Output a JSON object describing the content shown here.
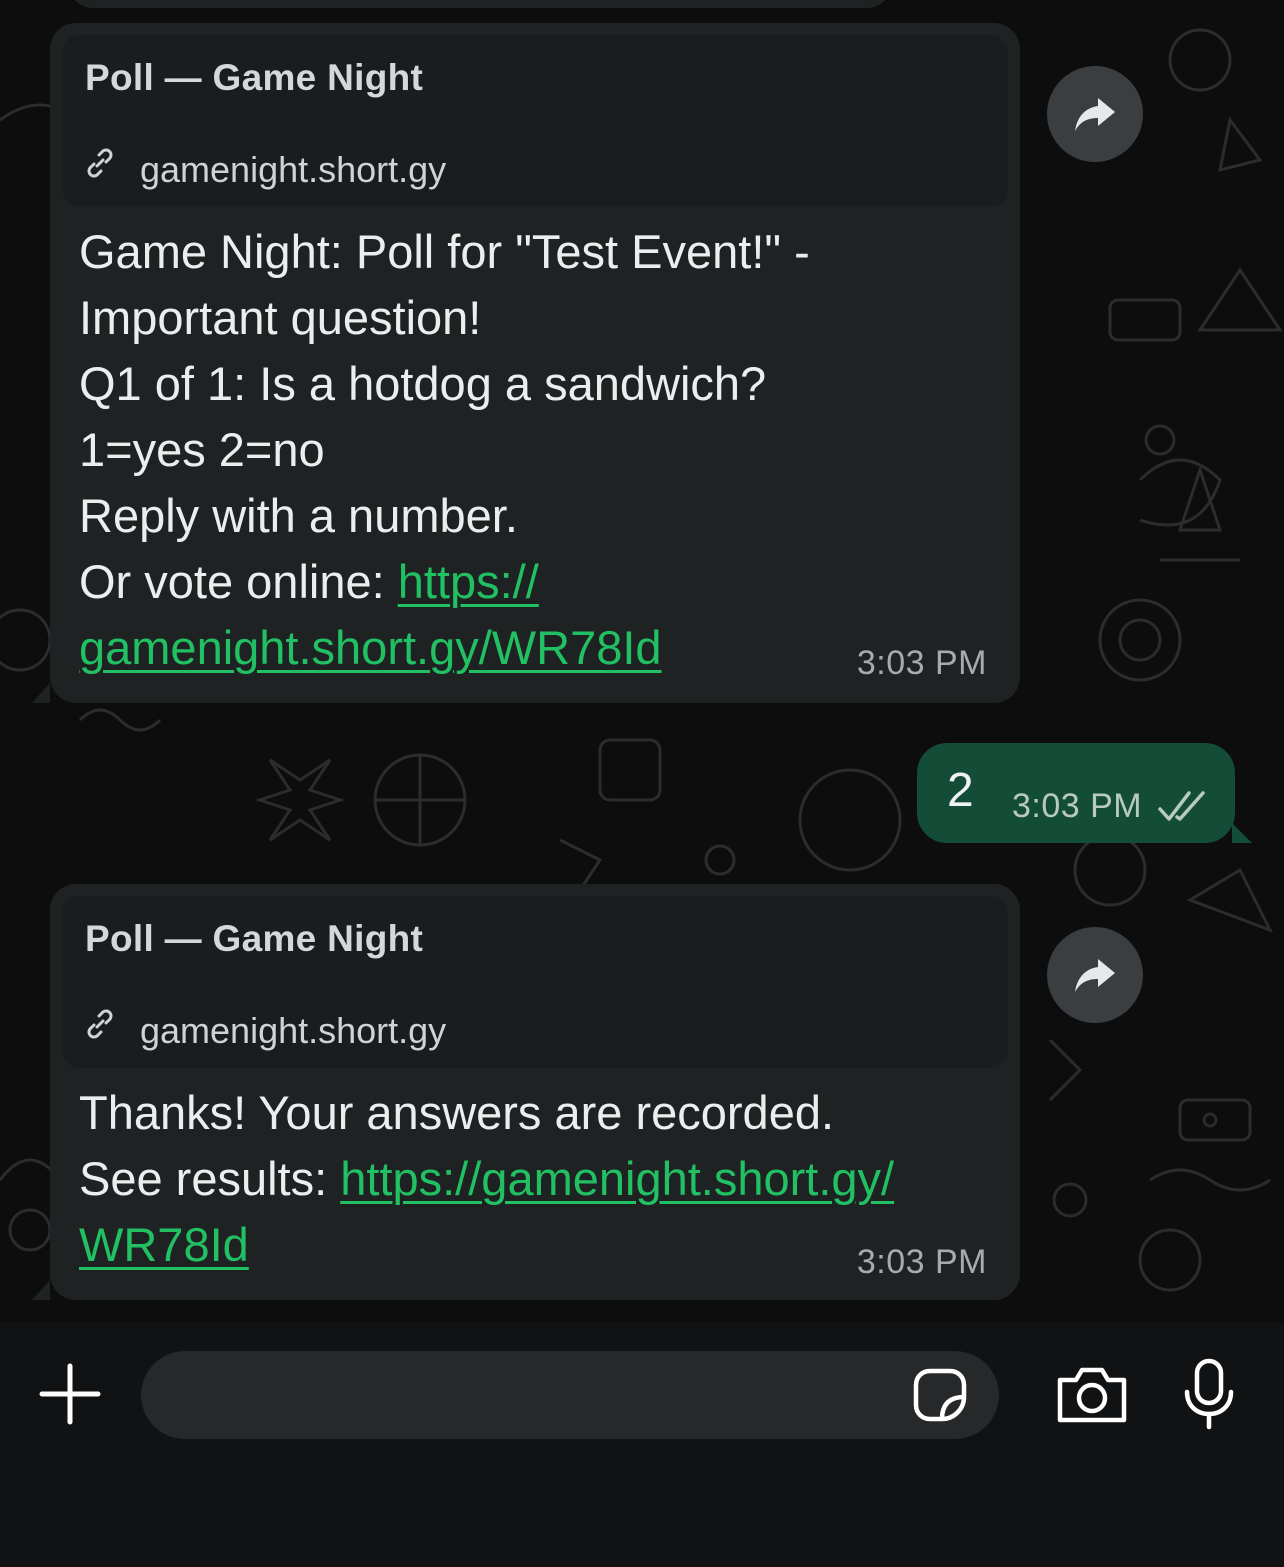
{
  "messages": [
    {
      "direction": "incoming",
      "preview_title": "Poll — Game Night",
      "preview_domain": "gamenight.short.gy",
      "lines": [
        "Game Night: Poll for \"Test Event!\" -",
        "Important question!",
        "Q1 of 1: Is a hotdog a sandwich?",
        "1=yes 2=no",
        "Reply with a number."
      ],
      "link_prefix": "Or vote online: ",
      "link_part1": "https://",
      "link_part2": "gamenight.short.gy/WR78Id",
      "time": "3:03 PM"
    },
    {
      "direction": "outgoing",
      "text": "2",
      "time": "3:03 PM",
      "status": "read"
    },
    {
      "direction": "incoming",
      "preview_title": "Poll — Game Night",
      "preview_domain": "gamenight.short.gy",
      "lines": [
        "Thanks! Your answers are recorded."
      ],
      "link_prefix": "See results: ",
      "link_part1": "https://gamenight.short.gy/",
      "link_part2": "WR78Id",
      "time": "3:03 PM"
    }
  ],
  "composer": {
    "placeholder": "",
    "icons": [
      "plus-icon",
      "sticker-icon",
      "camera-icon",
      "microphone-icon"
    ]
  },
  "colors": {
    "background": "#0d0d0d",
    "incoming_bubble": "#1f2223",
    "outgoing_bubble": "#134d37",
    "link": "#21c063",
    "read_ticks": "#b8c9c0"
  }
}
